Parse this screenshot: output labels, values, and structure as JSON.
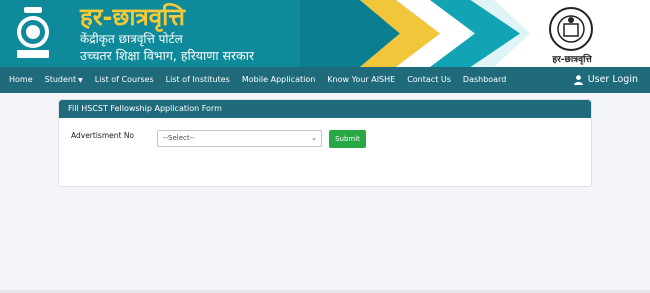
{
  "header": {
    "title": "हर-छात्रवृत्ति",
    "subtitle1": "केंद्रीकृत छात्रवृत्ति पोर्टल",
    "subtitle2": "उच्चतर शिक्षा विभाग, हरियाणा सरकार",
    "dept_caption": "हर-छात्रवृत्ति"
  },
  "nav": {
    "items": [
      "Home",
      "Student",
      "List of Courses",
      "List of Institutes",
      "Mobile Application",
      "Know Your AISHE",
      "Contact Us",
      "Dashboard"
    ],
    "user_login": "User Login"
  },
  "form": {
    "heading": "Fill HSCST Fellowship Application Form",
    "advertisment_label": "Advertisment No",
    "select_value": "--Select--",
    "submit_label": "Submit"
  },
  "colors": {
    "teal": "#0e8a9b",
    "nav": "#1f6b7c",
    "yellow": "#f2c63a",
    "green": "#28a745"
  },
  "icons": [
    "haryana-emblem-icon",
    "department-logo-icon",
    "user-icon",
    "caret-down-icon"
  ]
}
